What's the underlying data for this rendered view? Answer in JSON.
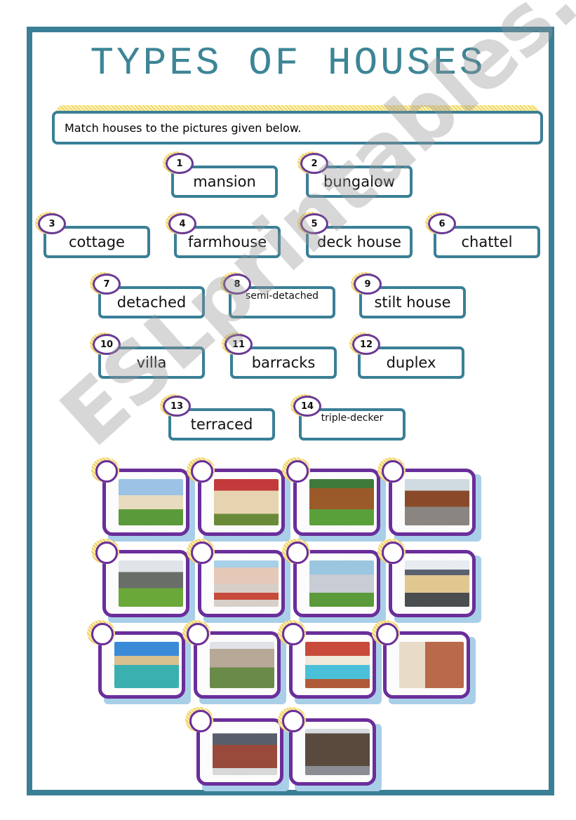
{
  "title": "TYPES OF HOUSES",
  "instruction": "Match houses to the pictures given below.",
  "watermark": "ESLprintables.com",
  "words": [
    {
      "number": "1",
      "label": "mansion"
    },
    {
      "number": "2",
      "label": "bungalow"
    },
    {
      "number": "3",
      "label": "cottage"
    },
    {
      "number": "4",
      "label": "farmhouse"
    },
    {
      "number": "5",
      "label": "deck house"
    },
    {
      "number": "6",
      "label": "chattel"
    },
    {
      "number": "7",
      "label": "detached"
    },
    {
      "number": "8",
      "label": "semi-detached"
    },
    {
      "number": "9",
      "label": "stilt house"
    },
    {
      "number": "10",
      "label": "villa"
    },
    {
      "number": "11",
      "label": "barracks"
    },
    {
      "number": "12",
      "label": "duplex"
    },
    {
      "number": "13",
      "label": "terraced"
    },
    {
      "number": "14",
      "label": "triple-decker"
    }
  ],
  "pictures": [
    {
      "depicts": "modern single-storey house with lawn",
      "answer": ""
    },
    {
      "depicts": "small red-roofed wooden house",
      "answer": ""
    },
    {
      "depicts": "wooden house with deck in forest",
      "answer": ""
    },
    {
      "depicts": "modern wooden deck house",
      "answer": ""
    },
    {
      "depicts": "stone farmhouse with garden",
      "answer": ""
    },
    {
      "depicts": "large mansion with flower roundabout",
      "answer": ""
    },
    {
      "depicts": "duplex with two garages",
      "answer": ""
    },
    {
      "depicts": "semi-detached yellow houses",
      "answer": ""
    },
    {
      "depicts": "house on stilts over water",
      "answer": ""
    },
    {
      "depicts": "barracks buildings around courtyard",
      "answer": ""
    },
    {
      "depicts": "villa with swimming pool",
      "answer": ""
    },
    {
      "depicts": "row of townhouses",
      "answer": ""
    },
    {
      "depicts": "terraced brick houses",
      "answer": ""
    },
    {
      "depicts": "three-storey triple-decker",
      "answer": ""
    }
  ]
}
